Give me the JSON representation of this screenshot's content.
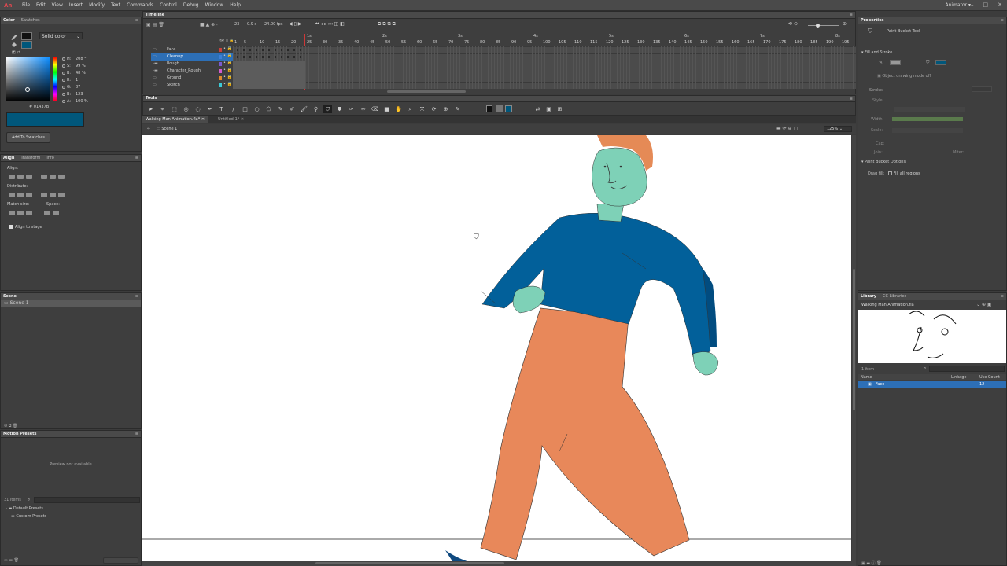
{
  "app": {
    "logo": "An",
    "menus": [
      "File",
      "Edit",
      "View",
      "Insert",
      "Modify",
      "Text",
      "Commands",
      "Control",
      "Debug",
      "Window",
      "Help"
    ],
    "workspace": "Animator ▾"
  },
  "color_panel": {
    "tabs": [
      "Color",
      "Swatches"
    ],
    "type": "Solid color",
    "fields": [
      {
        "k": "H:",
        "v": "208 °"
      },
      {
        "k": "S:",
        "v": "99 %"
      },
      {
        "k": "B:",
        "v": "48 %"
      },
      {
        "k": "R:",
        "v": "1"
      },
      {
        "k": "G:",
        "v": "87"
      },
      {
        "k": "B:",
        "v": "123"
      },
      {
        "k": "A:",
        "v": "100 %"
      }
    ],
    "hex_prefix": "#",
    "hex": "01437B",
    "add_button": "Add To Swatches",
    "fill_color": "#01577B"
  },
  "align_panel": {
    "tabs": [
      "Align",
      "Transform",
      "Info"
    ],
    "align_label": "Align:",
    "distribute_label": "Distribute:",
    "match_size_label": "Match size:",
    "space_label": "Space:",
    "stage_label": "Align to stage"
  },
  "scene_panel": {
    "title": "Scene",
    "items": [
      "Scene 1"
    ]
  },
  "motion_panel": {
    "title": "Motion Presets",
    "preview": "Preview not available",
    "count": "31 items",
    "folders": [
      "Default Presets",
      "Custom Presets"
    ]
  },
  "timeline": {
    "title": "Timeline",
    "fps": "24.00 fps",
    "frame": "23",
    "time": "0.9 s",
    "ruler": [
      "1",
      "5",
      "10",
      "15",
      "20",
      "25",
      "30",
      "35",
      "40",
      "45",
      "50",
      "55",
      "60",
      "65",
      "70",
      "75",
      "80",
      "85",
      "90",
      "95",
      "100",
      "105",
      "110",
      "115",
      "120",
      "125",
      "130",
      "135",
      "140",
      "145",
      "150",
      "155",
      "160",
      "165",
      "170",
      "175",
      "180",
      "185",
      "190",
      "195"
    ],
    "seconds": [
      "1s",
      "2s",
      "3s",
      "4s",
      "5s",
      "6s",
      "7s",
      "8s"
    ],
    "layers": [
      {
        "name": "Face",
        "color": "#c8413b"
      },
      {
        "name": "Cleanup",
        "color": "#3c7fd6",
        "selected": true
      },
      {
        "name": "Rough",
        "color": "#7a5bd0"
      },
      {
        "name": "Character_Rough",
        "color": "#d45bd0"
      },
      {
        "name": "Ground",
        "color": "#e08a2c"
      },
      {
        "name": "Sketch",
        "color": "#3cc9d6"
      }
    ]
  },
  "tools": {
    "title": "Tools",
    "stroke_color": "#111111",
    "fill_color": "#01577B"
  },
  "doc": {
    "tabs": [
      "Walking Man Animation.fla*",
      "Untitled-1*"
    ],
    "scene": "Scene 1",
    "zoom": "125%"
  },
  "properties": {
    "title": "Properties",
    "tool": "Paint Bucket Tool",
    "fill_stroke": "Fill and Stroke",
    "object_drawing": "Object drawing mode off",
    "stroke_label": "Stroke:",
    "style_label": "Style:",
    "width_label": "Width:",
    "scale_label": "Scale:",
    "cap_label": "Cap:",
    "join_label": "Join:",
    "miter_label": "Miter:",
    "pb_options": "Paint Bucket Options",
    "drag_fill": "Drag fill:",
    "fill_regions": "Fill all regions",
    "fill_color": "#01577B"
  },
  "library": {
    "tabs": [
      "Library",
      "CC Libraries"
    ],
    "file": "Walking Man Animation.fla",
    "count": "1 item",
    "col_name": "Name",
    "col_linkage": "Linkage",
    "col_use": "Use Count",
    "items": [
      {
        "name": "Face",
        "use": "12"
      }
    ]
  },
  "character": {
    "skin": "#7ED1B7",
    "hair": "#E58A56",
    "shirt": "#02609A",
    "shirt_dark": "#014C80",
    "pants": "#E8885A",
    "ground": "#555555"
  }
}
